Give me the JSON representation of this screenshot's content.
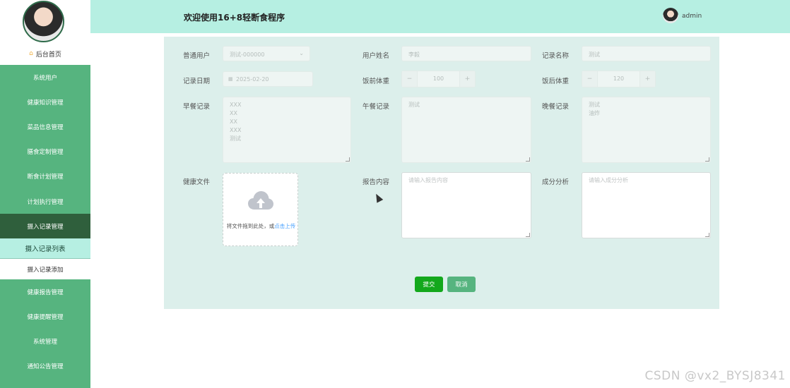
{
  "header": {
    "title": "欢迎使用16+8轻断食程序",
    "username": "admin"
  },
  "sidebar": {
    "home": "后台首页",
    "items": [
      {
        "label": "系统用户"
      },
      {
        "label": "健康知识管理"
      },
      {
        "label": "菜品信息管理"
      },
      {
        "label": "膳食定制管理"
      },
      {
        "label": "断食计划管理"
      },
      {
        "label": "计划执行管理"
      },
      {
        "label": "摄入记录管理",
        "active": true
      },
      {
        "label": "摄入记录列表",
        "sub": true,
        "selected": true
      },
      {
        "label": "摄入记录添加",
        "sub": true
      },
      {
        "label": "健康报告管理"
      },
      {
        "label": "健康提醒管理"
      },
      {
        "label": "系统管理"
      },
      {
        "label": "通知公告管理"
      }
    ]
  },
  "form": {
    "user_label": "普通用户",
    "user_value": "测试-000000",
    "name_label": "用户姓名",
    "name_value": "李毅",
    "record_label": "记录名称",
    "record_value": "测试",
    "date_label": "记录日期",
    "date_value": "2025-02-20",
    "before_weight_label": "饭前体重",
    "before_weight_value": "100",
    "after_weight_label": "饭后体重",
    "after_weight_value": "120",
    "breakfast_label": "早餐记录",
    "breakfast_value": "XXX\nXX\nXX\nXXX\n测试",
    "lunch_label": "午餐记录",
    "lunch_value": "测试",
    "dinner_label": "晚餐记录",
    "dinner_value": "测试\n油炸",
    "health_file_label": "健康文件",
    "upload_text": "将文件拖到此处，或",
    "upload_link": "点击上传",
    "report_label": "报告内容",
    "report_placeholder": "请输入报告内容",
    "analysis_label": "成分分析",
    "analysis_placeholder": "请输入成分分析",
    "submit": "提交",
    "cancel": "取消"
  },
  "watermark": "CSDN @vx2_BYSJ8341",
  "colors": {
    "sidebar": "#56b47f",
    "header": "#b6efe2",
    "panel": "#dcefeb",
    "submit": "#13a81c",
    "link": "#409eff"
  }
}
